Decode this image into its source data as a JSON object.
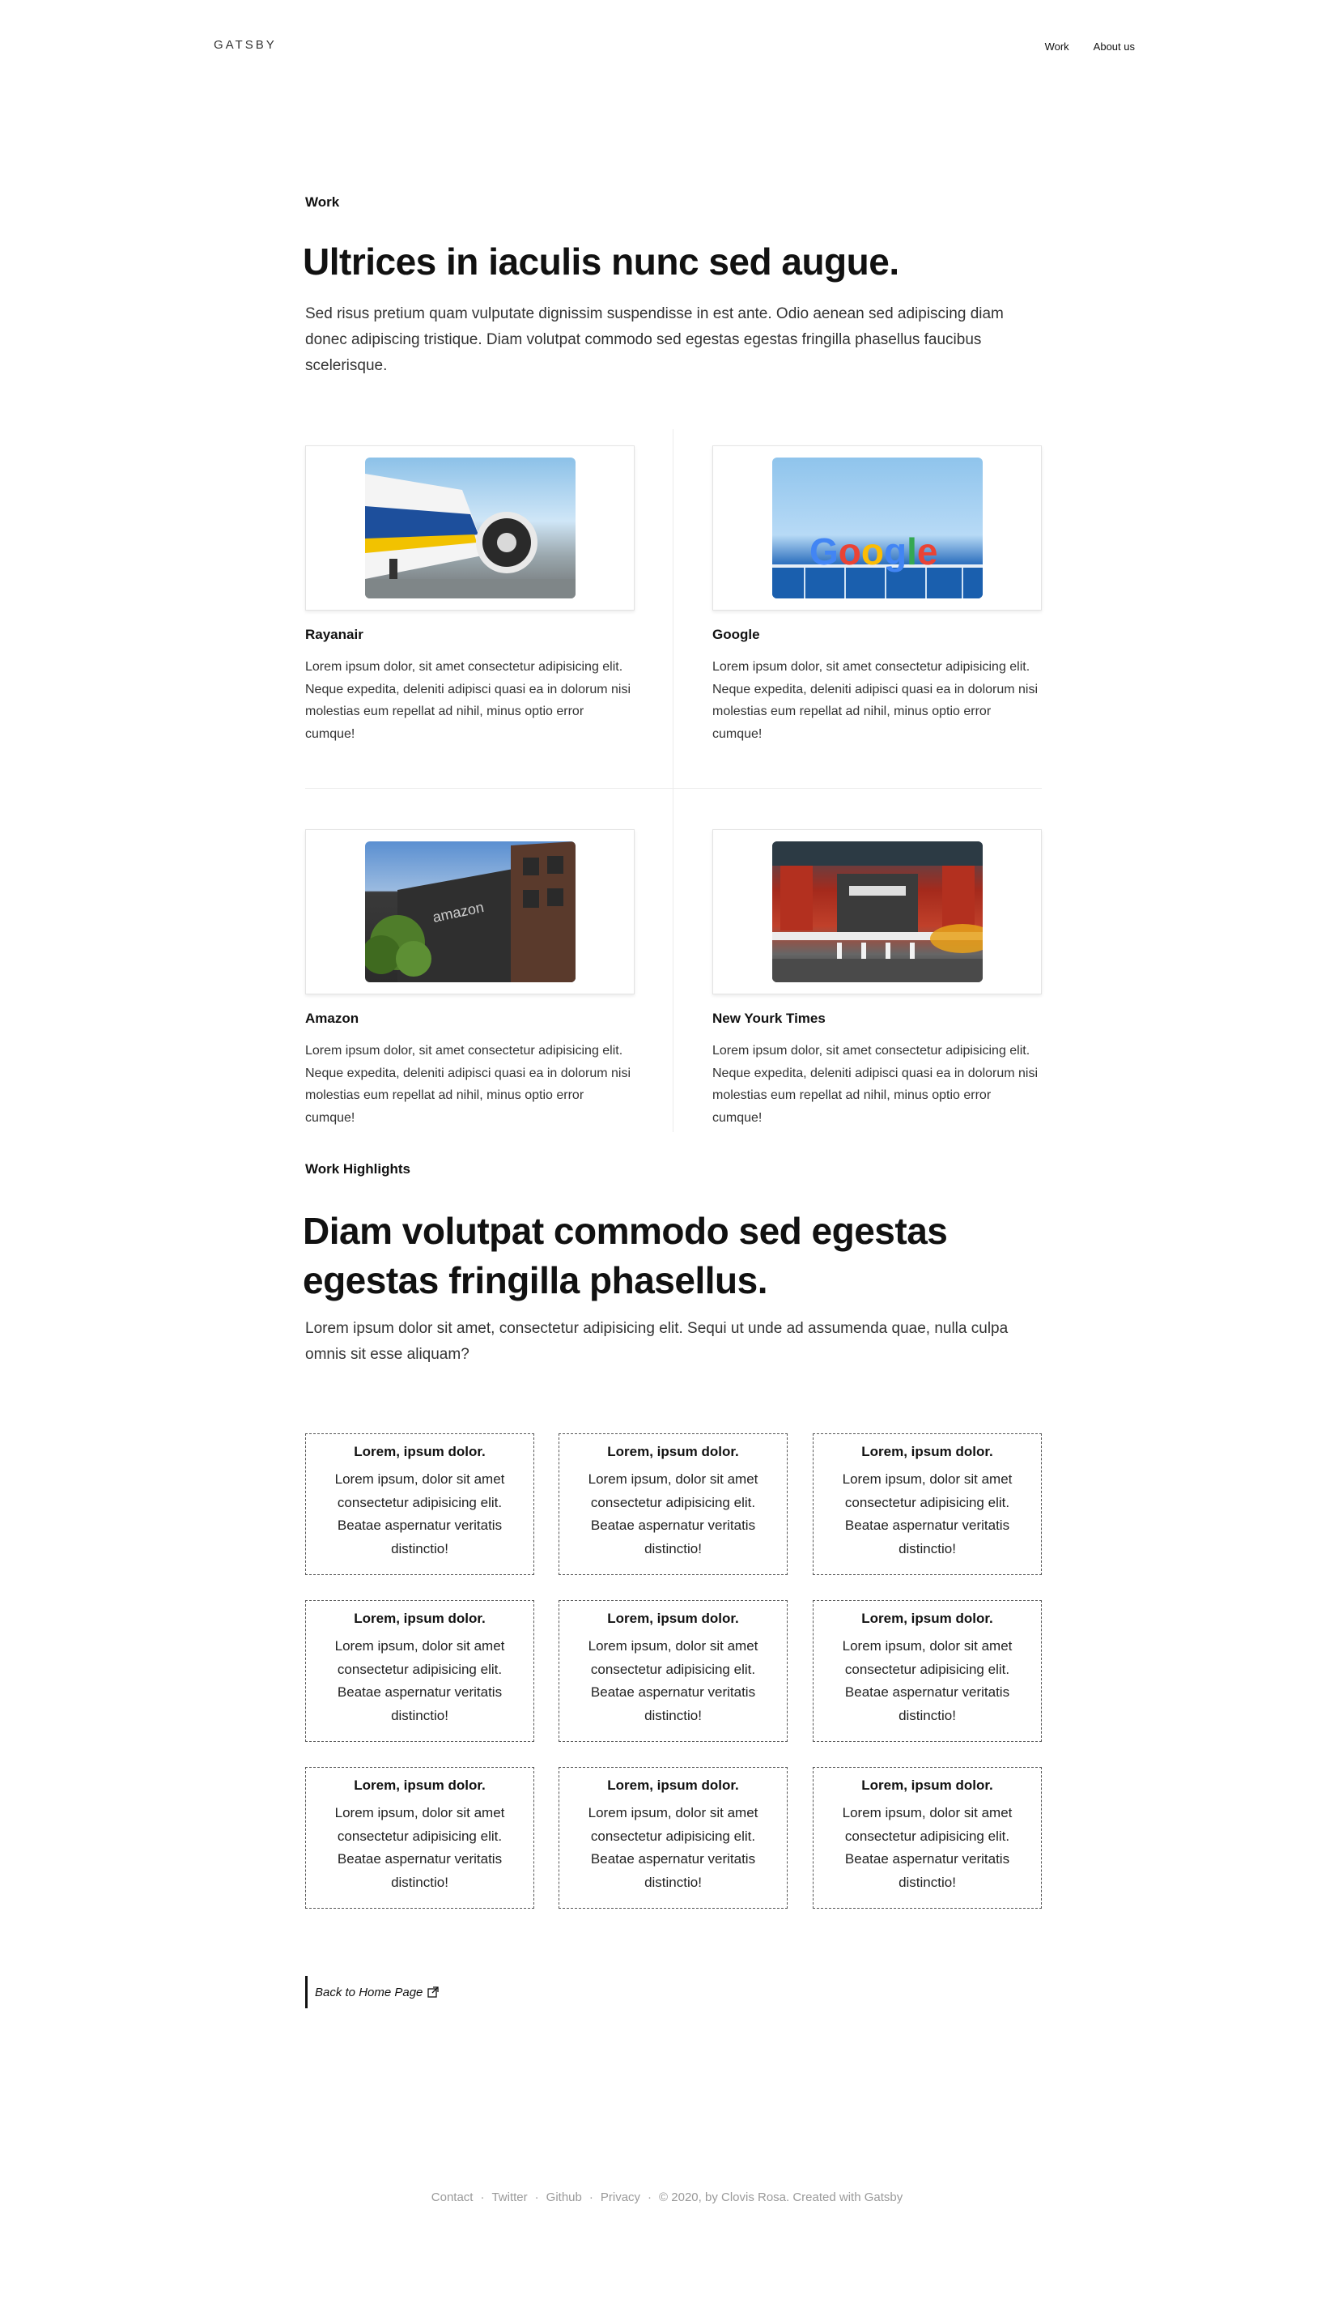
{
  "header": {
    "brand": "GATSBY",
    "nav": [
      {
        "label": "Work"
      },
      {
        "label": "About us"
      }
    ]
  },
  "work": {
    "eyebrow": "Work",
    "headline": "Ultrices in iaculis nunc sed augue.",
    "lead": "Sed risus pretium quam vulputate dignissim suspendisse in est ante. Odio aenean sed adipiscing diam donec adipiscing tristique. Diam volutpat commodo sed egestas egestas fringilla phasellus faucibus scelerisque.",
    "cards": [
      {
        "title": "Rayanair",
        "image": "airplane-jet-engine-photo",
        "desc": "Lorem ipsum dolor, sit amet consectetur adipisicing elit. Neque expedita, deleniti adipisci quasi ea in dolorum nisi molestias eum repellat ad nihil, minus optio error cumque!"
      },
      {
        "title": "Google",
        "image": "google-sign-building-photo",
        "logo_text": "Google",
        "desc": "Lorem ipsum dolor, sit amet consectetur adipisicing elit. Neque expedita, deleniti adipisci quasi ea in dolorum nisi molestias eum repellat ad nihil, minus optio error cumque!"
      },
      {
        "title": "Amazon",
        "image": "amazon-building-photo",
        "desc": "Lorem ipsum dolor, sit amet consectetur adipisicing elit. Neque expedita, deleniti adipisci quasi ea in dolorum nisi molestias eum repellat ad nihil, minus optio error cumque!"
      },
      {
        "title": "New Yourk Times",
        "image": "new-york-times-building-photo",
        "desc": "Lorem ipsum dolor, sit amet consectetur adipisicing elit. Neque expedita, deleniti adipisci quasi ea in dolorum nisi molestias eum repellat ad nihil, minus optio error cumque!"
      }
    ]
  },
  "highlights": {
    "eyebrow": "Work Highlights",
    "headline_line1": "Diam volutpat commodo sed egestas",
    "headline_line2": "egestas fringilla phasellus.",
    "lead": "Lorem ipsum dolor sit amet, consectetur adipisicing elit. Sequi ut unde ad assumenda quae, nulla culpa omnis sit esse aliquam?",
    "items": [
      {
        "title": "Lorem, ipsum dolor.",
        "text": "Lorem ipsum, dolor sit amet consectetur adipisicing elit. Beatae aspernatur veritatis distinctio!"
      },
      {
        "title": "Lorem, ipsum dolor.",
        "text": "Lorem ipsum, dolor sit amet consectetur adipisicing elit. Beatae aspernatur veritatis distinctio!"
      },
      {
        "title": "Lorem, ipsum dolor.",
        "text": "Lorem ipsum, dolor sit amet consectetur adipisicing elit. Beatae aspernatur veritatis distinctio!"
      },
      {
        "title": "Lorem, ipsum dolor.",
        "text": "Lorem ipsum, dolor sit amet consectetur adipisicing elit. Beatae aspernatur veritatis distinctio!"
      },
      {
        "title": "Lorem, ipsum dolor.",
        "text": "Lorem ipsum, dolor sit amet consectetur adipisicing elit. Beatae aspernatur veritatis distinctio!"
      },
      {
        "title": "Lorem, ipsum dolor.",
        "text": "Lorem ipsum, dolor sit amet consectetur adipisicing elit. Beatae aspernatur veritatis distinctio!"
      },
      {
        "title": "Lorem, ipsum dolor.",
        "text": "Lorem ipsum, dolor sit amet consectetur adipisicing elit. Beatae aspernatur veritatis distinctio!"
      },
      {
        "title": "Lorem, ipsum dolor.",
        "text": "Lorem ipsum, dolor sit amet consectetur adipisicing elit. Beatae aspernatur veritatis distinctio!"
      },
      {
        "title": "Lorem, ipsum dolor.",
        "text": "Lorem ipsum, dolor sit amet consectetur adipisicing elit. Beatae aspernatur veritatis distinctio!"
      }
    ]
  },
  "back_link": {
    "label": "Back to Home Page",
    "icon": "external-link-icon"
  },
  "footer": {
    "links": [
      "Contact",
      "Twitter",
      "Github",
      "Privacy"
    ],
    "separator": "·",
    "copyright": "© 2020, by Clovis Rosa. Created with Gatsby"
  },
  "colors": {
    "text": "#111111",
    "muted": "#9a9a9a",
    "divider": "#ececec",
    "google_blue": "#4285f4",
    "google_red": "#ea4335",
    "google_yellow": "#fbbc05",
    "google_green": "#34a853"
  }
}
